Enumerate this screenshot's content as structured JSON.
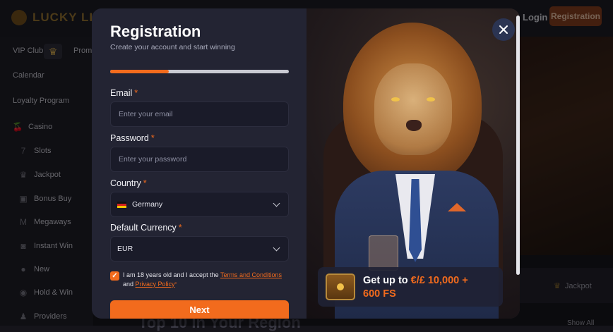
{
  "header": {
    "logo_text": "LUCKY LION",
    "login_label": "Login",
    "registration_label": "Registration"
  },
  "sidebar": {
    "items": [
      {
        "label": "VIP Club",
        "icon": "crown-icon"
      },
      {
        "label": "Calendar"
      },
      {
        "label": "Loyalty Program"
      },
      {
        "label": "Casino",
        "icon": "cherries-icon"
      },
      {
        "label": "Slots",
        "icon": "seven-icon"
      },
      {
        "label": "Jackpot",
        "icon": "crown-icon"
      },
      {
        "label": "Bonus Buy",
        "icon": "gift-icon"
      },
      {
        "label": "Megaways",
        "icon": "m-icon"
      },
      {
        "label": "Instant Win",
        "icon": "gamepad-icon"
      },
      {
        "label": "New",
        "icon": "new-badge-icon"
      },
      {
        "label": "Hold & Win",
        "icon": "coins-icon"
      },
      {
        "label": "Providers",
        "icon": "provider-icon"
      }
    ],
    "promo_label": "Prome"
  },
  "background": {
    "jackpot_label": "Jackpot",
    "section_title": "Top 10 In Your Region",
    "show_all_label": "Show All"
  },
  "modal": {
    "title": "Registration",
    "subtitle": "Create your account and start winning",
    "progress_percent": 33,
    "email": {
      "label": "Email",
      "placeholder": "Enter your email",
      "value": ""
    },
    "password": {
      "label": "Password",
      "placeholder": "Enter your password",
      "value": ""
    },
    "country": {
      "label": "Country",
      "value": "Germany"
    },
    "currency": {
      "label": "Default Currency",
      "value": "EUR"
    },
    "required_marker": "*",
    "terms": {
      "prefix": "I am 18 years old and I accept the",
      "terms_link": "Terms and Conditions",
      "and": "and",
      "privacy_link": "Privacy Policy",
      "suffix": "*",
      "checked": true
    },
    "next_label": "Next",
    "promo": {
      "lead": "Get up to",
      "highlight": "€/£ 10,000",
      "plus": "+",
      "tail": "600 FS"
    }
  },
  "colors": {
    "accent": "#f26b1d",
    "modal_bg": "#232433",
    "field_bg": "#1a1b29"
  }
}
